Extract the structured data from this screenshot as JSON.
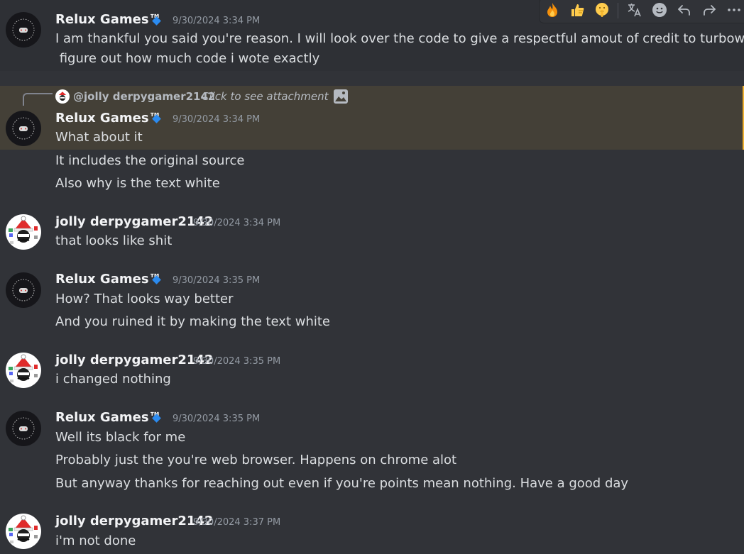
{
  "toolbar": {
    "reactions": [
      "fire-emoji",
      "thumbs-up-emoji",
      "shushing-face-emoji"
    ],
    "actions": [
      "translate-icon",
      "add-reaction-icon",
      "reply-icon",
      "forward-icon",
      "more-icon"
    ]
  },
  "reply_preview": {
    "user": "@jolly derpygamer2142",
    "text": "Click to see attachment"
  },
  "messages": [
    {
      "author": "Relux Games™",
      "time": "9/30/2024 3:34 PM",
      "lines": [
        "I am thankful you said you're reason. I will look over the code to give a respectful amout of credit to turbowarp",
        " figure out how much code i wote exactly"
      ]
    },
    {
      "author": "Relux Games™",
      "time": "9/30/2024 3:34 PM",
      "lines": [
        "What about it",
        "It includes the original source",
        "Also why is the text white"
      ]
    },
    {
      "author": "jolly derpygamer2142",
      "time": "9/30/2024 3:34 PM",
      "lines": [
        "that looks like shit"
      ]
    },
    {
      "author": "Relux Games™",
      "time": "9/30/2024 3:35 PM",
      "lines": [
        "How? That looks way better",
        "And you ruined it by making the text white"
      ]
    },
    {
      "author": "jolly derpygamer2142",
      "time": "9/30/2024 3:35 PM",
      "lines": [
        "i changed nothing"
      ]
    },
    {
      "author": "Relux Games™",
      "time": "9/30/2024 3:35 PM",
      "lines": [
        "Well its black for me",
        "Probably just the you're web browser. Happens on chrome alot",
        "But anyway thanks for reaching out even if you're points mean nothing. Have a good day"
      ]
    },
    {
      "author": "jolly derpygamer2142",
      "time": "9/30/2024 3:37 PM",
      "lines": [
        "i'm not done"
      ]
    }
  ],
  "colors": {
    "background": "#313338",
    "hover": "#2e3035",
    "reply_highlight": "#444037",
    "username": "#f2f3f5",
    "timestamp": "#949ba4",
    "text": "#dbdee1",
    "badge": "#2b8bf0"
  }
}
